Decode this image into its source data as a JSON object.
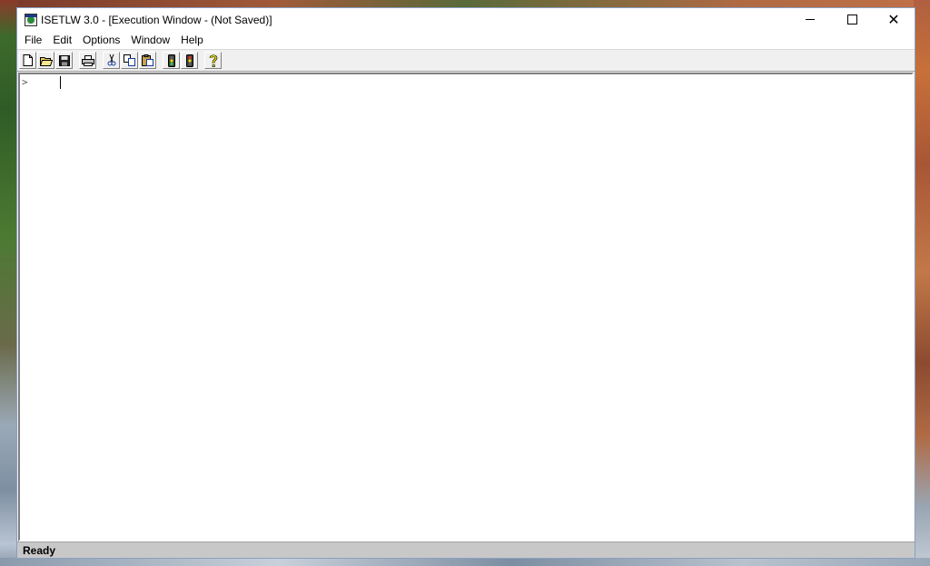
{
  "window": {
    "title": "ISETLW 3.0 - [Execution Window - (Not Saved)]"
  },
  "menu": {
    "items": [
      "File",
      "Edit",
      "Options",
      "Window",
      "Help"
    ]
  },
  "toolbar": {
    "buttons": [
      "new-file-icon",
      "open-folder-icon",
      "save-icon",
      "print-icon",
      "cut-icon",
      "copy-icon",
      "paste-icon",
      "run-icon",
      "stop-icon",
      "help-icon"
    ]
  },
  "editor": {
    "prompt": ">"
  },
  "status": {
    "text": "Ready"
  },
  "colors": {
    "accent_green": "#2a8a3a",
    "help_yellow": "#e8e000",
    "status_bar": "#c8c8c8"
  }
}
